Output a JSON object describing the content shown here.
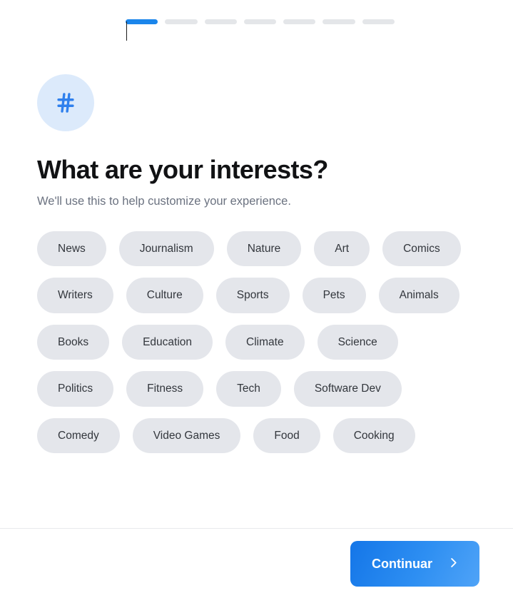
{
  "progress": {
    "total_steps": 7,
    "current_step": 1,
    "active_color": "#1a85eb",
    "inactive_color": "#e4e6e9"
  },
  "header": {
    "icon": "hash-icon",
    "icon_color": "#2f80ed",
    "icon_background": "#dceafb",
    "title": "What are your interests?",
    "subtitle": "We'll use this to help customize your experience."
  },
  "interests": {
    "tags": [
      {
        "label": "News",
        "selected": false
      },
      {
        "label": "Journalism",
        "selected": false
      },
      {
        "label": "Nature",
        "selected": false
      },
      {
        "label": "Art",
        "selected": false
      },
      {
        "label": "Comics",
        "selected": false
      },
      {
        "label": "Writers",
        "selected": false
      },
      {
        "label": "Culture",
        "selected": false
      },
      {
        "label": "Sports",
        "selected": false
      },
      {
        "label": "Pets",
        "selected": false
      },
      {
        "label": "Animals",
        "selected": false
      },
      {
        "label": "Books",
        "selected": false
      },
      {
        "label": "Education",
        "selected": false
      },
      {
        "label": "Climate",
        "selected": false
      },
      {
        "label": "Science",
        "selected": false
      },
      {
        "label": "Politics",
        "selected": false
      },
      {
        "label": "Fitness",
        "selected": false
      },
      {
        "label": "Tech",
        "selected": false
      },
      {
        "label": "Software Dev",
        "selected": false
      },
      {
        "label": "Comedy",
        "selected": false
      },
      {
        "label": "Video Games",
        "selected": false
      },
      {
        "label": "Food",
        "selected": false
      },
      {
        "label": "Cooking",
        "selected": false
      }
    ],
    "chip_background": "#e4e6eb",
    "chip_text_color": "#33373d"
  },
  "footer": {
    "continue_label": "Continuar",
    "continue_icon": "chevron-right-icon",
    "button_color": "#2e8ff2"
  }
}
